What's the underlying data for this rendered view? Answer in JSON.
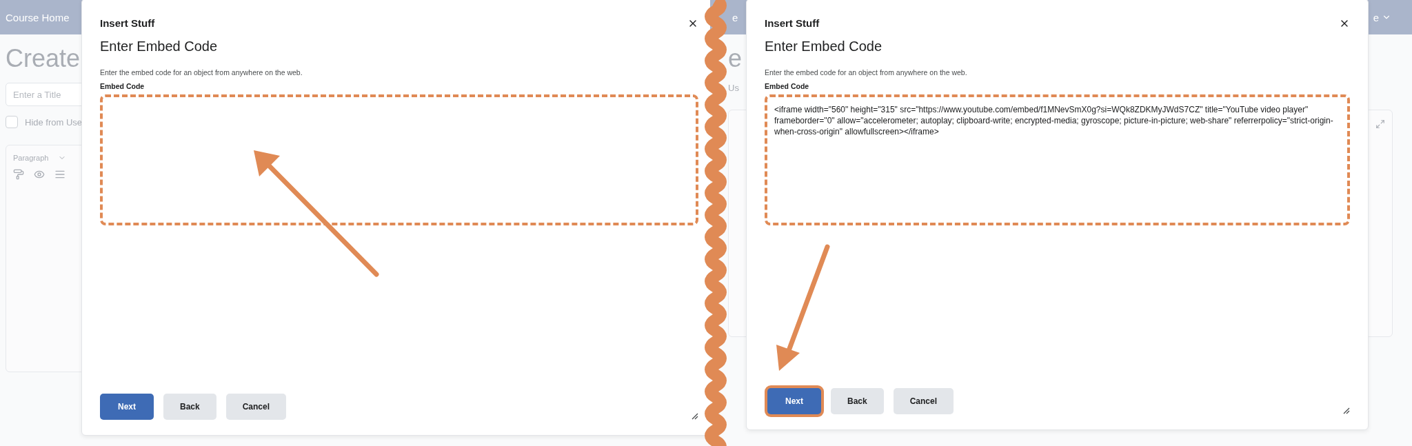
{
  "panels": [
    {
      "background": {
        "header_text": "Course Home",
        "page_title": "Create",
        "title_field": {
          "placeholder": "Enter a Title"
        },
        "checkbox": {
          "label": "Hide from Use",
          "checked": false
        },
        "editor": {
          "kind": "format",
          "format": "Paragraph"
        }
      },
      "dialog": {
        "title": "Insert Stuff",
        "heading": "Enter Embed Code",
        "description": "Enter the embed code for an object from anywhere on the web.",
        "field_label": "Embed Code",
        "field": {
          "highlighted": true
        },
        "buttons": [
          {
            "label": "Next",
            "kind": "primary",
            "highlighted": false
          },
          {
            "label": "Back",
            "kind": "secondary",
            "highlighted": false
          },
          {
            "label": "Cancel",
            "kind": "secondary",
            "highlighted": false
          }
        ]
      },
      "arrow": {
        "kind": "up"
      }
    },
    {
      "background": {
        "header_text": "e",
        "header_menu": "e",
        "page_title": "e",
        "checkbox": {
          "label": "Us"
        },
        "editor": {
          "kind": "actions"
        }
      },
      "dialog": {
        "title": "Insert Stuff",
        "heading": "Enter Embed Code",
        "description": "Enter the embed code for an object from anywhere on the web.",
        "field_label": "Embed Code",
        "field": {
          "value": "<iframe width=\"560\" height=\"315\" src=\"https://www.youtube.com/embed/f1MNevSmX0g?si=WQk8ZDKMyJWdS7CZ\" title=\"YouTube video player\" frameborder=\"0\" allow=\"accelerometer; autoplay; clipboard-write; encrypted-media; gyroscope; picture-in-picture; web-share\" referrerpolicy=\"strict-origin-when-cross-origin\" allowfullscreen></iframe>",
          "highlighted": true
        },
        "buttons": [
          {
            "label": "Next",
            "kind": "primary",
            "highlighted": true
          },
          {
            "label": "Back",
            "kind": "secondary",
            "highlighted": false
          },
          {
            "label": "Cancel",
            "kind": "secondary",
            "highlighted": false
          }
        ]
      },
      "arrow": {
        "kind": "down"
      }
    }
  ]
}
